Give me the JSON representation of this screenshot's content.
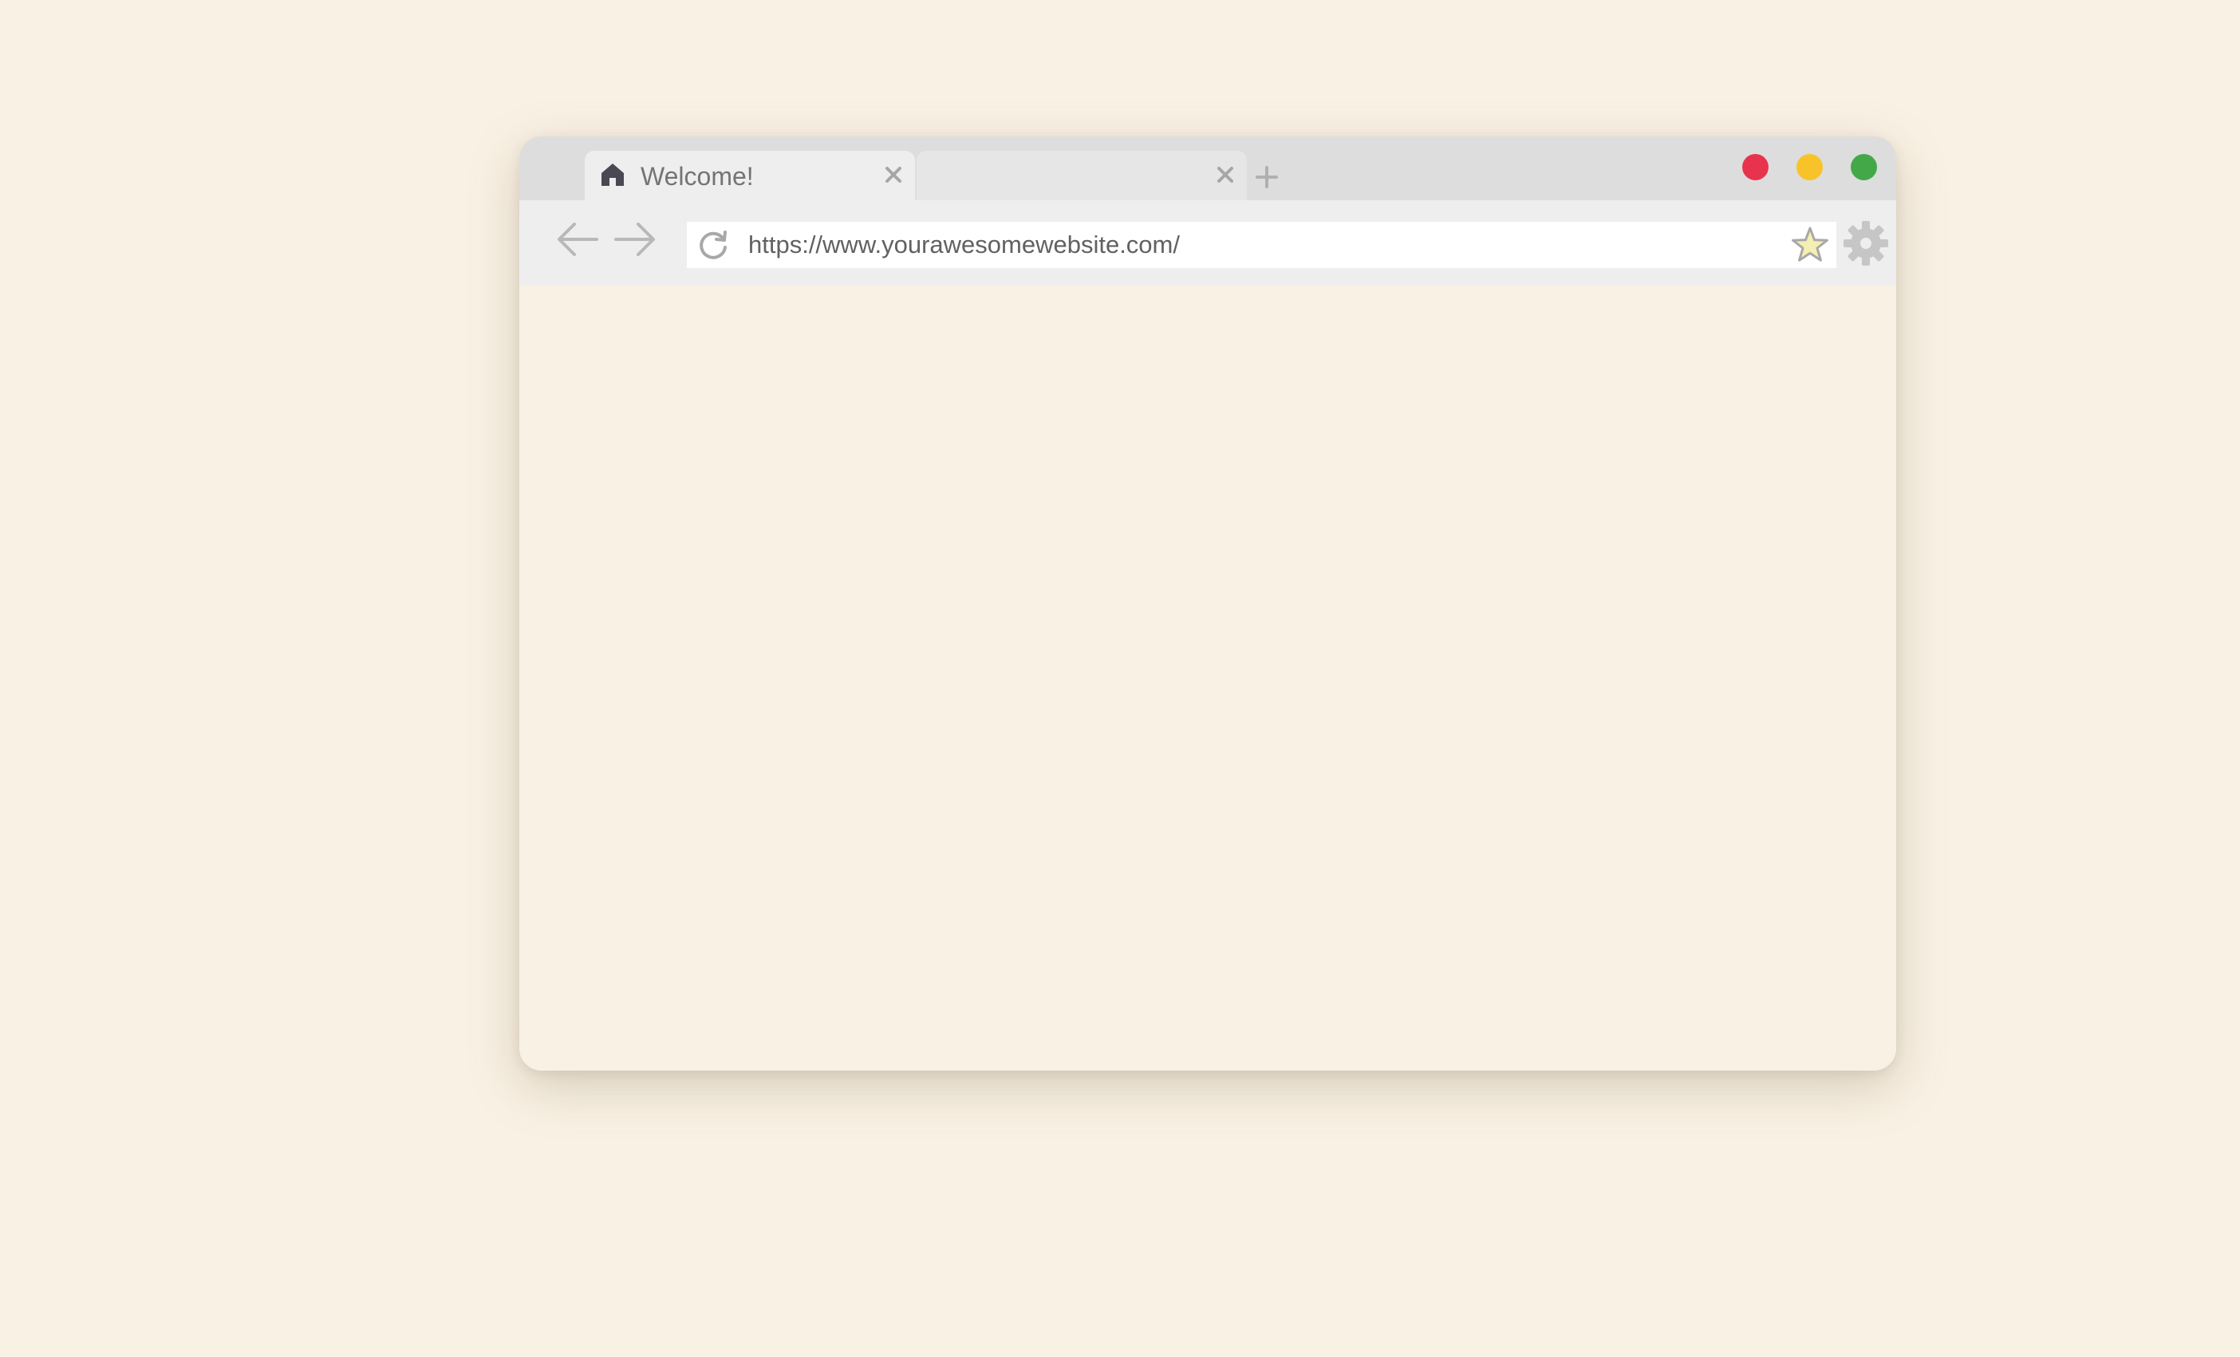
{
  "window": {
    "background": "#f9f1e4"
  },
  "tabs": [
    {
      "label": "Welcome!",
      "icon": "home-icon",
      "active": true,
      "close_icon": "close-icon"
    },
    {
      "label": "",
      "active": false,
      "close_icon": "close-icon"
    }
  ],
  "new_tab_icon": "plus-icon",
  "window_controls": [
    {
      "name": "close",
      "color": "#e8334f"
    },
    {
      "name": "minimize",
      "color": "#f7c328"
    },
    {
      "name": "maximize",
      "color": "#43a948"
    }
  ],
  "toolbar": {
    "back_icon": "arrow-left-icon",
    "forward_icon": "arrow-right-icon",
    "reload_icon": "reload-icon",
    "url": "https://www.yourawesomewebsite.com/",
    "bookmark_icon": "star-icon",
    "settings_icon": "gear-icon"
  }
}
